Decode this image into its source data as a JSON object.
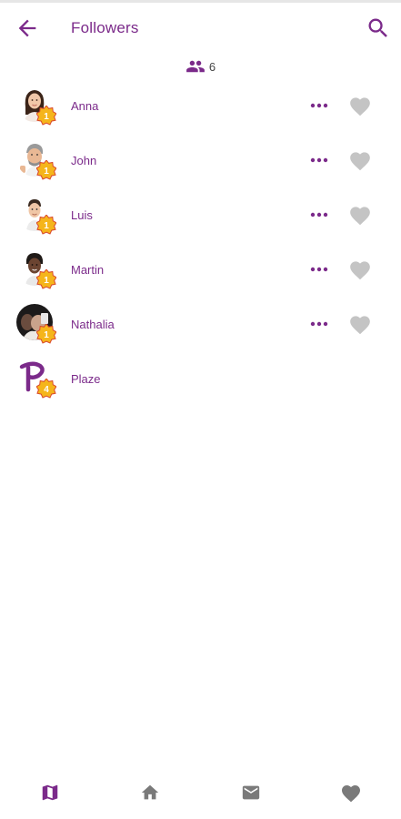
{
  "header": {
    "title": "Followers",
    "back_icon": "arrow-back-icon",
    "search_icon": "search-icon"
  },
  "followers_count": {
    "icon": "people-icon",
    "value": "6"
  },
  "followers": [
    {
      "name": "Anna",
      "badge": "1",
      "avatar": "female-avatar",
      "has_actions": true
    },
    {
      "name": "John",
      "badge": "1",
      "avatar": "male-avatar-gray-hair",
      "has_actions": true
    },
    {
      "name": "Luis",
      "badge": "1",
      "avatar": "male-avatar",
      "has_actions": true
    },
    {
      "name": "Martin",
      "badge": "1",
      "avatar": "male-avatar-dark",
      "has_actions": true
    },
    {
      "name": "Nathalia",
      "badge": "1",
      "avatar": "photo-avatar",
      "has_actions": true
    },
    {
      "name": "Plaze",
      "badge": "4",
      "avatar": "plaze-logo",
      "has_actions": false
    }
  ],
  "bottom_nav": [
    {
      "icon": "map-icon",
      "active": true
    },
    {
      "icon": "home-icon",
      "active": false
    },
    {
      "icon": "mail-icon",
      "active": false
    },
    {
      "icon": "heart-icon",
      "active": false
    }
  ],
  "colors": {
    "accent": "#7b2a8a",
    "inactive": "#7a7a7a",
    "heart": "#c4c4c4",
    "badge": "#f5b51b"
  }
}
